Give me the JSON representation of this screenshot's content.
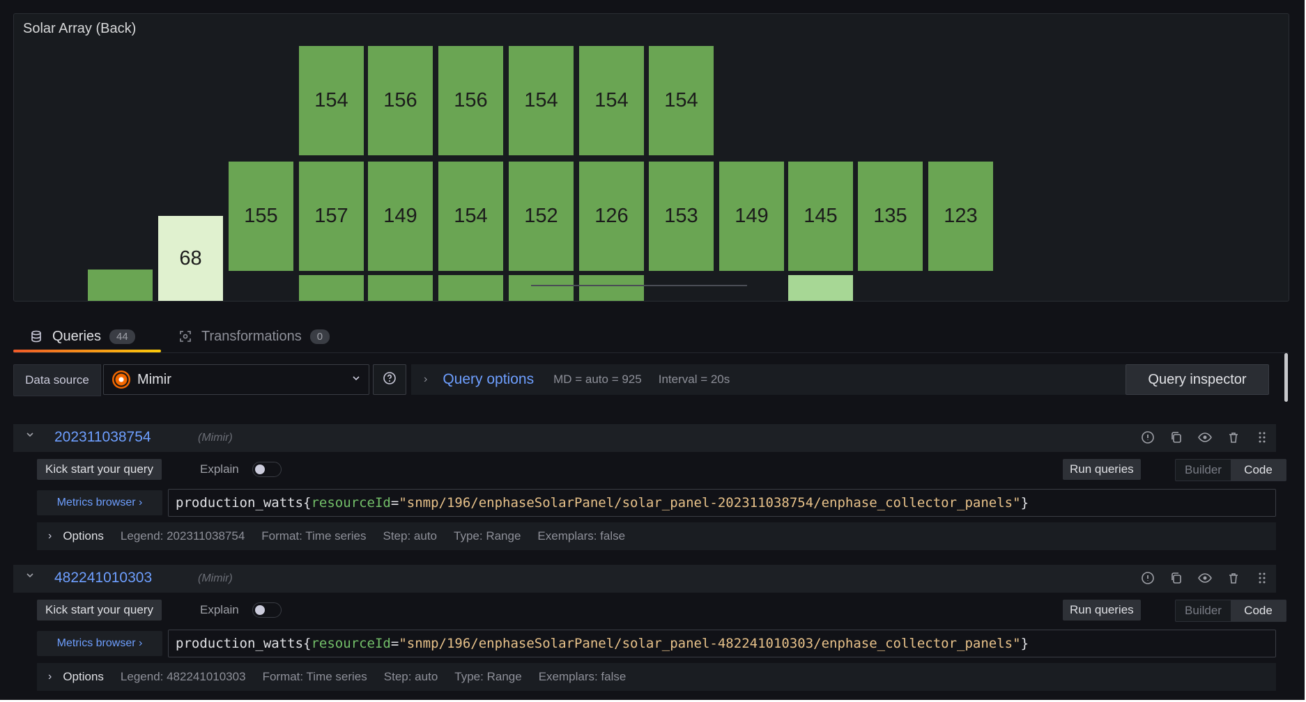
{
  "panel": {
    "title": "Solar Array (Back)",
    "tiles": [
      {
        "value": "154"
      },
      {
        "value": "156"
      },
      {
        "value": "156"
      },
      {
        "value": "154"
      },
      {
        "value": "154"
      },
      {
        "value": "154"
      },
      {
        "value": "155"
      },
      {
        "value": "157"
      },
      {
        "value": "149"
      },
      {
        "value": "154"
      },
      {
        "value": "152"
      },
      {
        "value": "126"
      },
      {
        "value": "153"
      },
      {
        "value": "149"
      },
      {
        "value": "145"
      },
      {
        "value": "135"
      },
      {
        "value": "123"
      },
      {
        "value": "68"
      }
    ]
  },
  "tabs": {
    "queries": {
      "label": "Queries",
      "count": "44"
    },
    "transformations": {
      "label": "Transformations",
      "count": "0"
    }
  },
  "toolbar": {
    "data_source_label": "Data source",
    "data_source_name": "Mimir",
    "query_options_label": "Query options",
    "md_info": "MD = auto = 925",
    "interval_info": "Interval = 20s",
    "query_inspector": "Query inspector"
  },
  "queries": [
    {
      "ref_id": "202311038754",
      "datasource": "(Mimir)",
      "kick_start": "Kick start your query",
      "explain": "Explain",
      "run": "Run queries",
      "builder": "Builder",
      "code": "Code",
      "metrics_browser": "Metrics browser ›",
      "metric": "production_watts{",
      "label_key": "resourceId",
      "eq": "=",
      "label_value": "\"snmp/196/enphaseSolarPanel/solar_panel-202311038754/enphase_collector_panels\"",
      "close": "}",
      "options_title": "Options",
      "legend": "Legend: 202311038754",
      "format": "Format: Time series",
      "step": "Step: auto",
      "type": "Type: Range",
      "exemplars": "Exemplars: false"
    },
    {
      "ref_id": "482241010303",
      "datasource": "(Mimir)",
      "kick_start": "Kick start your query",
      "explain": "Explain",
      "run": "Run queries",
      "builder": "Builder",
      "code": "Code",
      "metrics_browser": "Metrics browser ›",
      "metric": "production_watts{",
      "label_key": "resourceId",
      "eq": "=",
      "label_value": "\"snmp/196/enphaseSolarPanel/solar_panel-482241010303/enphase_collector_panels\"",
      "close": "}",
      "options_title": "Options",
      "legend": "Legend: 482241010303",
      "format": "Format: Time series",
      "step": "Step: auto",
      "type": "Type: Range",
      "exemplars": "Exemplars: false"
    }
  ],
  "colors": {
    "tile_green": "#6aa553",
    "tile_light": "#e0f1cf",
    "accent_blue": "#6e9fff",
    "tab_underline": "#f05a28"
  }
}
